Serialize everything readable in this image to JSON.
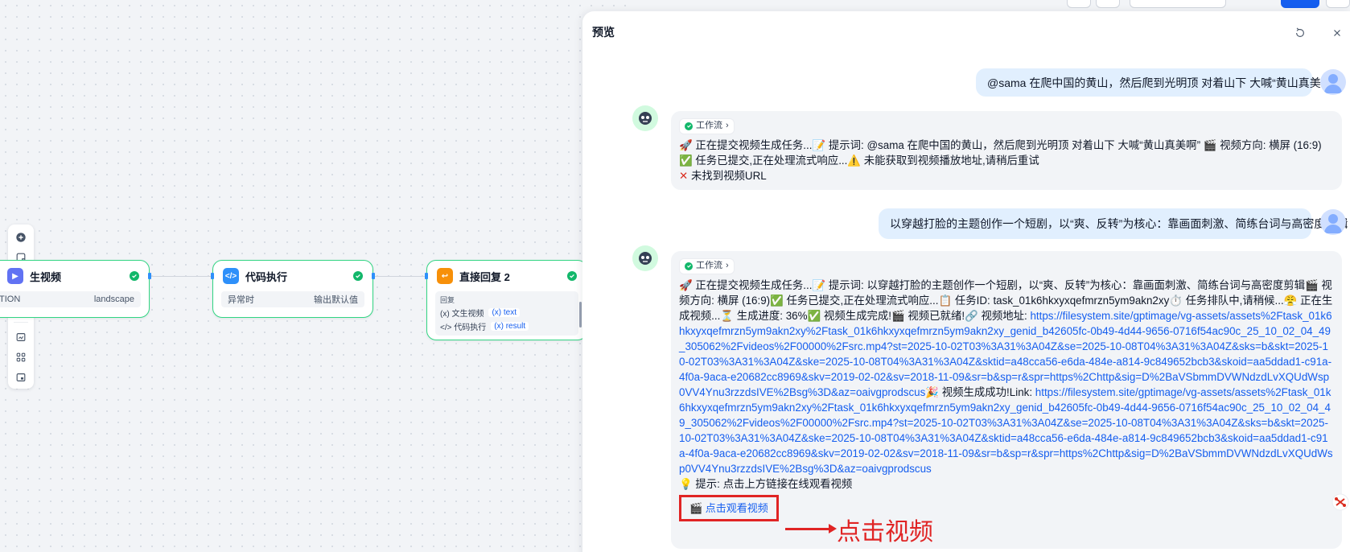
{
  "canvas": {
    "nodes": [
      {
        "id": "text-to-video",
        "title": "生视频",
        "row_left": "TION",
        "row_right": "landscape"
      },
      {
        "id": "code-exec",
        "title": "代码执行",
        "row_left": "异常时",
        "row_right": "输出默认值"
      },
      {
        "id": "direct-reply",
        "title": "直接回复 2",
        "reply_label": "回复",
        "vars": [
          {
            "source": "文生视频",
            "var": "text"
          },
          {
            "source": "代码执行",
            "var": "result"
          }
        ]
      }
    ],
    "var_prefix": "{x}"
  },
  "panel": {
    "title": "预览",
    "messages": [
      {
        "role": "user",
        "text": "@sama 在爬中国的黄山，然后爬到光明顶 对着山下 大喊“黄山真美啊”"
      },
      {
        "role": "bot",
        "chip": "工作流",
        "line1": "🚀 正在提交视频生成任务...📝 提示词: @sama 在爬中国的黄山，然后爬到光明顶 对着山下 大喊“黄山真美啊” 🎬 视频方向: 横屏 (16:9)✅ 任务已提交,正在处理流式响应...⚠️ 未能获取到视频播放地址,请稍后重试",
        "line2": "未找到视频URL"
      },
      {
        "role": "user",
        "text": "以穿越打脸的主题创作一个短剧，以“爽、反转”为核心：靠画面刺激、简练台词与高密度剪辑"
      },
      {
        "role": "bot",
        "chip": "工作流",
        "text_a": "🚀 正在提交视频生成任务...📝 提示词: 以穿越打脸的主题创作一个短剧，以“爽、反转”为核心：靠画面刺激、简练台词与高密度剪辑🎬 视频方向: 横屏 (16:9)✅ 任务已提交,正在处理流式响应...📋 任务ID: task_01k6hkxyxqefmrzn5ym9akn2xy⏱️ 任务排队中,请稍候...😤 正在生成视频...⏳ 生成进度: 36%✅ 视频生成完成!🎬 视频已就绪!🔗 视频地址: ",
        "link1": "https://filesystem.site/gptimage/vg-assets/assets%2Ftask_01k6hkxyxqefmrzn5ym9akn2xy%2Ftask_01k6hkxyxqefmrzn5ym9akn2xy_genid_b42605fc-0b49-4d44-9656-0716f54ac90c_25_10_02_04_49_305062%2Fvideos%2F00000%2Fsrc.mp4?st=2025-10-02T03%3A31%3A04Z&se=2025-10-08T04%3A31%3A04Z&sks=b&skt=2025-10-02T03%3A31%3A04Z&ske=2025-10-08T04%3A31%3A04Z&sktid=a48cca56-e6da-484e-a814-9c849652bcb3&skoid=aa5ddad1-c91a-4f0a-9aca-e20682cc8969&skv=2019-02-02&sv=2018-11-09&sr=b&sp=r&spr=https%2Chttp&sig=D%2BaVSbmmDVWNdzdLvXQUdWsp0VV4Ynu3rzzdsIVE%2Bsg%3D&az=oaivgprodscus",
        "text_b": "🎉 视频生成成功!Link: ",
        "link2": "https://filesystem.site/gptimage/vg-assets/assets%2Ftask_01k6hkxyxqefmrzn5ym9akn2xy%2Ftask_01k6hkxyxqefmrzn5ym9akn2xy_genid_b42605fc-0b49-4d44-9656-0716f54ac90c_25_10_02_04_49_305062%2Fvideos%2F00000%2Fsrc.mp4?st=2025-10-02T03%3A31%3A04Z&se=2025-10-08T04%3A31%3A04Z&sks=b&skt=2025-10-02T03%3A31%3A04Z&ske=2025-10-08T04%3A31%3A04Z&sktid=a48cca56-e6da-484e-a814-9c849652bcb3&skoid=aa5ddad1-c91a-4f0a-9aca-e20682cc8969&skv=2019-02-02&sv=2018-11-09&sr=b&sp=r&spr=https%2Chttp&sig=D%2BaVSbmmDVWNdzdLvXQUdWsp0VV4Ynu3rzzdsIVE%2Bsg%3D&az=oaivgprodscus",
        "tip": "💡 提示: 点击上方链接在线观看视频",
        "watch": "🎬 点击观看视频"
      }
    ]
  },
  "annotation": {
    "text": "点击视频",
    "color": "#e02424"
  },
  "colors": {
    "accent": "#155eef",
    "success": "#12b76a",
    "node_border": "#32d583",
    "user_bubble": "#e1effe"
  }
}
